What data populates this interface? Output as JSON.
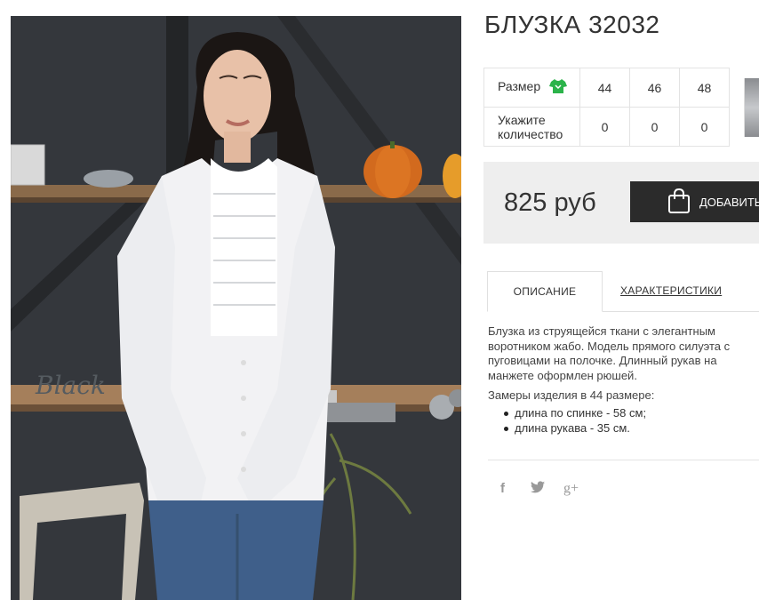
{
  "product": {
    "title": "БЛУЗКА 32032",
    "price": "825 руб"
  },
  "sizes": {
    "size_label": "Размер",
    "qty_label": "Укажите количество",
    "values": [
      "44",
      "46",
      "48"
    ],
    "quantities": [
      "0",
      "0",
      "0"
    ]
  },
  "cart": {
    "add_label": "ДОБАВИТЬ"
  },
  "tabs": {
    "description": "ОПИСАНИЕ",
    "characteristics": "ХАРАКТЕРИСТИКИ"
  },
  "description": {
    "text": "Блузка из струящейся ткани с элегантным воротником жабо. Модель прямого силуэта с пуговицами на полочке. Длинный рукав на манжете оформлен рюшей.",
    "measure_title": "Замеры изделия в 44 размере:",
    "measures": [
      "длина по спинке - 58 см;",
      "длина рукава - 35 см."
    ]
  },
  "share": {
    "facebook": "f",
    "twitter": "twitter-icon",
    "google": "g+"
  },
  "photo": {
    "shelf_text": "Black"
  },
  "colors": {
    "accent_green": "#2bb34a",
    "button_dark": "#2b2b2b",
    "price_bg": "#eeeeee"
  }
}
